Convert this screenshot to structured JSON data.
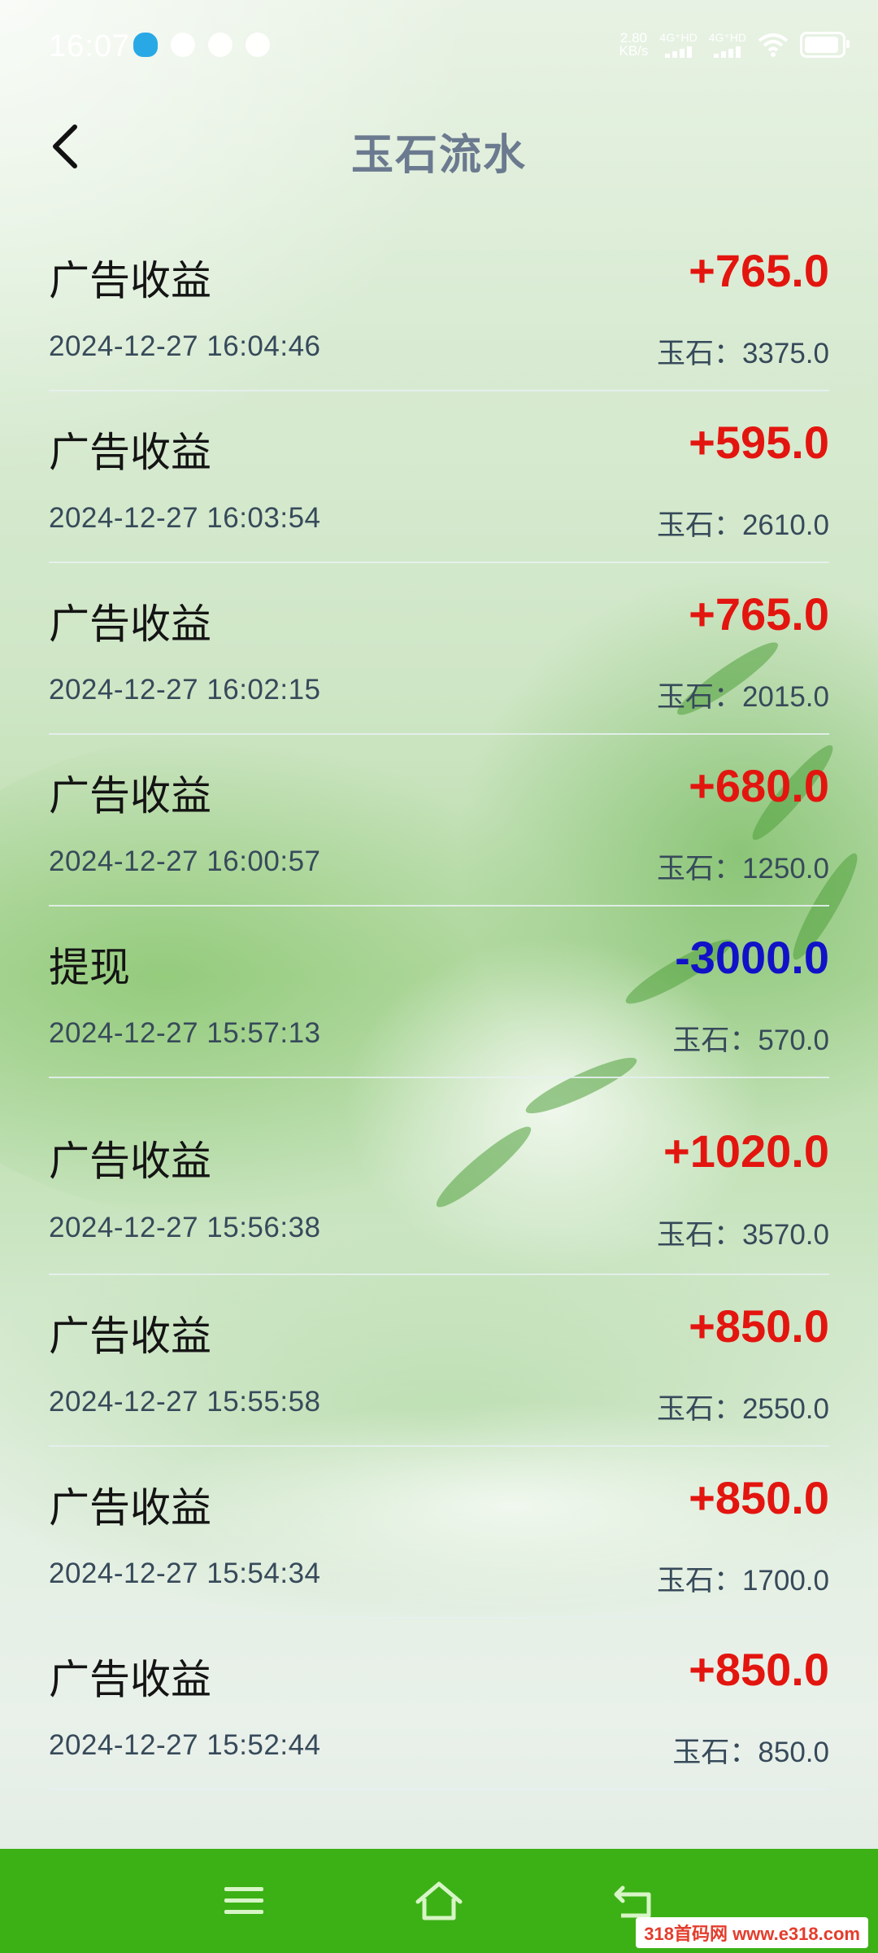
{
  "status_bar": {
    "time": "16:07",
    "net_speed_value": "2.80",
    "net_speed_unit": "KB/s",
    "signal1_label": "4G⁺HD",
    "signal2_label": "4G⁺HD"
  },
  "header": {
    "title": "玉石流水"
  },
  "records": [
    {
      "type": "广告收益",
      "amount": "+765.0",
      "time": "2024-12-27 16:04:46",
      "balance": "玉石：3375.0",
      "amount_color": "#e3150f"
    },
    {
      "type": "广告收益",
      "amount": "+595.0",
      "time": "2024-12-27 16:03:54",
      "balance": "玉石：2610.0",
      "amount_color": "#e3150f"
    },
    {
      "type": "广告收益",
      "amount": "+765.0",
      "time": "2024-12-27 16:02:15",
      "balance": "玉石：2015.0",
      "amount_color": "#e3150f"
    },
    {
      "type": "广告收益",
      "amount": "+680.0",
      "time": "2024-12-27 16:00:57",
      "balance": "玉石：1250.0",
      "amount_color": "#e3150f"
    },
    {
      "type": "提现",
      "amount": "-3000.0",
      "time": "2024-12-27 15:57:13",
      "balance": "玉石：570.0",
      "amount_color": "#1111c8"
    },
    {
      "type": "广告收益",
      "amount": "+1020.0",
      "time": "2024-12-27 15:56:38",
      "balance": "玉石：3570.0",
      "amount_color": "#e3150f"
    },
    {
      "type": "广告收益",
      "amount": "+850.0",
      "time": "2024-12-27 15:55:58",
      "balance": "玉石：2550.0",
      "amount_color": "#e3150f"
    },
    {
      "type": "广告收益",
      "amount": "+850.0",
      "time": "2024-12-27 15:54:34",
      "balance": "玉石：1700.0",
      "amount_color": "#e3150f"
    },
    {
      "type": "广告收益",
      "amount": "+850.0",
      "time": "2024-12-27 15:52:44",
      "balance": "玉石：850.0",
      "amount_color": "#e3150f"
    }
  ],
  "navigation": {
    "icons": [
      "menu-icon",
      "home-icon",
      "back-icon"
    ],
    "color": "#3cb116"
  },
  "watermark": "318首码网 www.e318.com"
}
